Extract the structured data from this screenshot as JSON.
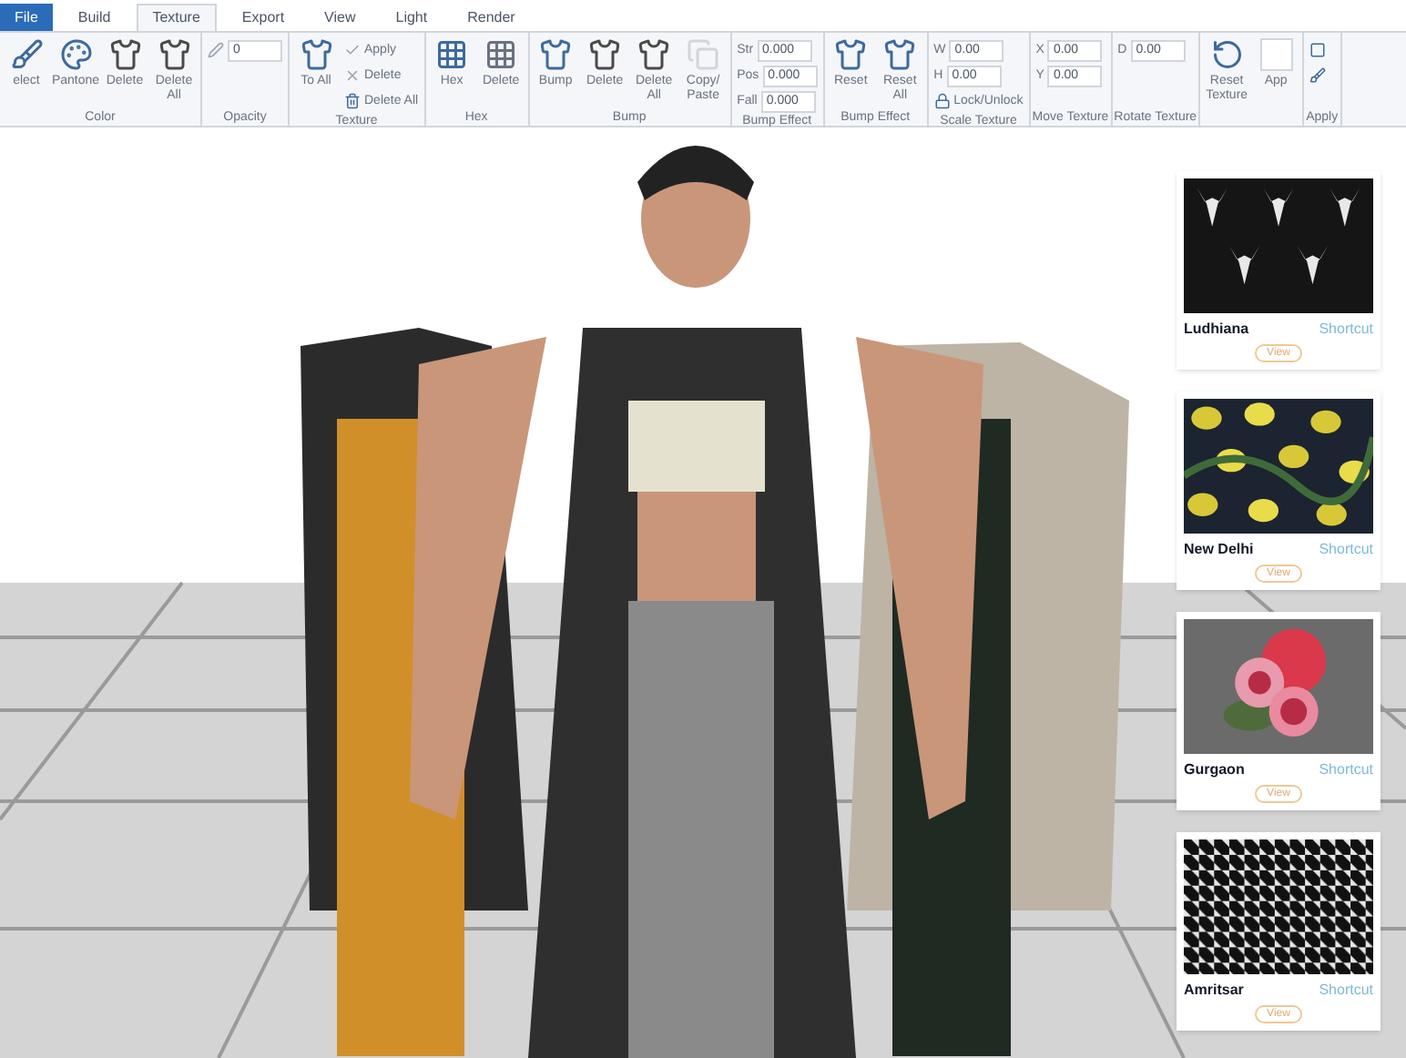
{
  "tabs": [
    {
      "label": "File",
      "selected": false,
      "kind": "file"
    },
    {
      "label": "Build",
      "selected": false,
      "kind": "tab"
    },
    {
      "label": "Texture",
      "selected": true,
      "kind": "tab"
    },
    {
      "label": "Export",
      "selected": false,
      "kind": "tab"
    },
    {
      "label": "View",
      "selected": false,
      "kind": "tab"
    },
    {
      "label": "Light",
      "selected": false,
      "kind": "tab"
    },
    {
      "label": "Render",
      "selected": false,
      "kind": "tab"
    }
  ],
  "ribbon": [
    {
      "label": "Color",
      "items": [
        {
          "kind": "large",
          "label": "elect"
        },
        {
          "kind": "large",
          "label": "Pantone"
        },
        {
          "kind": "large",
          "label": "Delete"
        },
        {
          "kind": "large",
          "label": "Delete All"
        }
      ]
    },
    {
      "label": "Opacity",
      "items": [
        {
          "kind": "column",
          "rows": [
            {
              "kind": "field",
              "value": "0"
            }
          ]
        }
      ]
    },
    {
      "label": "Texture",
      "items": [
        {
          "kind": "large",
          "label": "To All"
        },
        {
          "kind": "column",
          "rows": [
            {
              "kind": "small",
              "label": "Apply"
            },
            {
              "kind": "small",
              "label": "Delete"
            },
            {
              "kind": "small",
              "label": "Delete All"
            }
          ]
        }
      ]
    },
    {
      "label": "Hex",
      "items": [
        {
          "kind": "large",
          "label": "Hex"
        },
        {
          "kind": "large",
          "label": "Delete"
        }
      ]
    },
    {
      "label": "Bump",
      "items": [
        {
          "kind": "large",
          "label": "Bump"
        },
        {
          "kind": "large",
          "label": "Delete"
        },
        {
          "kind": "large",
          "label": "Delete All"
        },
        {
          "kind": "large",
          "label": "Copy/ Paste"
        }
      ]
    },
    {
      "label": "Bump Effect",
      "items": [
        {
          "kind": "column",
          "rows": [
            {
              "kind": "field",
              "label": "Str",
              "value": "0.000"
            },
            {
              "kind": "field",
              "label": "Pos",
              "value": "0.000"
            },
            {
              "kind": "field",
              "label": "Fall",
              "value": "0.000"
            }
          ]
        }
      ]
    },
    {
      "label": "Bump Effect",
      "items": [
        {
          "kind": "large",
          "label": "Reset"
        },
        {
          "kind": "large",
          "label": "Reset All"
        }
      ]
    },
    {
      "label": "Scale Texture",
      "items": [
        {
          "kind": "column",
          "rows": [
            {
              "kind": "field",
              "label": "W",
              "value": "0.00"
            },
            {
              "kind": "field",
              "label": "H",
              "value": "0.00"
            },
            {
              "kind": "small",
              "label": "Lock/Unlock"
            }
          ]
        }
      ]
    },
    {
      "label": "Move Texture",
      "items": [
        {
          "kind": "column",
          "rows": [
            {
              "kind": "field",
              "label": "X",
              "value": "0.00"
            },
            {
              "kind": "field",
              "label": "Y",
              "value": "0.00"
            }
          ]
        }
      ]
    },
    {
      "label": "Rotate Texture",
      "items": [
        {
          "kind": "column",
          "rows": [
            {
              "kind": "field",
              "label": "D",
              "value": "0.00"
            }
          ]
        }
      ]
    },
    {
      "items": [
        {
          "kind": "large",
          "label": "Reset Texture"
        },
        {
          "kind": "large",
          "label": "App"
        }
      ]
    },
    {
      "label": "Apply",
      "items": [
        {
          "kind": "column",
          "rows": [
            {
              "kind": "small"
            },
            {
              "kind": "small"
            }
          ]
        }
      ]
    }
  ],
  "textures": [
    {
      "name": "Ludhiana",
      "link": "Shortcut",
      "button": "View"
    },
    {
      "name": "New Delhi",
      "link": "Shortcut",
      "button": "View"
    },
    {
      "name": "Gurgaon",
      "link": "Shortcut",
      "button": "View"
    },
    {
      "name": "Amritsar",
      "link": "Shortcut",
      "button": "View"
    }
  ]
}
